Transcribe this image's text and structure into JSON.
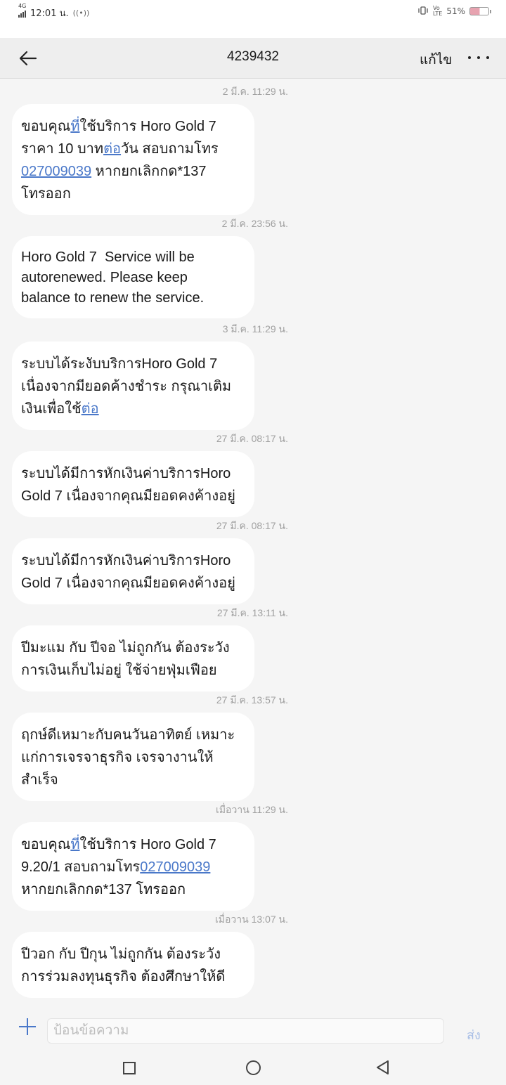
{
  "status_bar": {
    "time": "12:01 น.",
    "network": "4G",
    "battery_percent": "51%",
    "battery_level": 0.51
  },
  "header": {
    "title": "4239432",
    "edit_label": "แก้ไข",
    "back_icon": "arrow-left-icon",
    "more_icon": "more-horizontal-icon"
  },
  "messages": [
    {
      "timestamp": "2 มี.ค. 11:29 น.",
      "lines": [
        [
          {
            "t": "ขอบคุณ"
          },
          {
            "t": "ที่",
            "link": true
          },
          {
            "t": "ใช้บริการ Horo Gold 7"
          }
        ],
        [
          {
            "t": "ราคา 10 บาท"
          },
          {
            "t": "ต่อ",
            "link": true
          },
          {
            "t": "วัน สอบถามโทร"
          }
        ],
        [
          {
            "t": "027009039",
            "link": true
          },
          {
            "t": " หากยกเลิกกด*137"
          }
        ],
        [
          {
            "t": "โทรออก"
          }
        ]
      ]
    },
    {
      "timestamp": "2 มี.ค. 23:56 น.",
      "en": true,
      "lines": [
        [
          {
            "t": "Horo Gold 7  Service will be"
          }
        ],
        [
          {
            "t": "autorenewed. Please keep"
          }
        ],
        [
          {
            "t": "balance to renew the service."
          }
        ]
      ]
    },
    {
      "timestamp": "3 มี.ค. 11:29 น.",
      "lines": [
        [
          {
            "t": "ระบบได้ระงับบริการHoro Gold 7"
          }
        ],
        [
          {
            "t": "เนื่องจากมียอดค้างชำระ กรุณาเติม"
          }
        ],
        [
          {
            "t": "เงินเพื่อใช้"
          },
          {
            "t": "ต่อ",
            "link": true
          }
        ]
      ]
    },
    {
      "timestamp": "27 มี.ค. 08:17 น.",
      "lines": [
        [
          {
            "t": "ระบบได้มีการหักเงินค่าบริการHoro"
          }
        ],
        [
          {
            "t": "Gold 7 เนื่องจากคุณมียอดคงค้างอยู่"
          }
        ]
      ]
    },
    {
      "timestamp": "27 มี.ค. 08:17 น.",
      "lines": [
        [
          {
            "t": "ระบบได้มีการหักเงินค่าบริการHoro"
          }
        ],
        [
          {
            "t": "Gold 7 เนื่องจากคุณมียอดคงค้างอยู่"
          }
        ]
      ]
    },
    {
      "timestamp": "27 มี.ค. 13:11 น.",
      "lines": [
        [
          {
            "t": "ปีมะแม กับ ปีจอ ไม่ถูกกัน ต้องระวัง"
          }
        ],
        [
          {
            "t": "การเงินเก็บไม่อยู่ ใช้จ่ายฟุ่มเฟือย"
          }
        ]
      ]
    },
    {
      "timestamp": "27 มี.ค. 13:57 น.",
      "lines": [
        [
          {
            "t": "ฤกษ์ดีเหมาะกับคนวันอาทิตย์ เหมาะ"
          }
        ],
        [
          {
            "t": "แก่การเจรจาธุรกิจ เจรจางานให้"
          }
        ],
        [
          {
            "t": "สำเร็จ"
          }
        ]
      ]
    },
    {
      "timestamp": "เมื่อวาน 11:29 น.",
      "lines": [
        [
          {
            "t": "ขอบคุณ"
          },
          {
            "t": "ที่",
            "link": true
          },
          {
            "t": "ใช้บริการ Horo Gold 7"
          }
        ],
        [
          {
            "t": "9.20/1 สอบถามโทร"
          },
          {
            "t": "027009039",
            "link": true
          }
        ],
        [
          {
            "t": "หากยกเลิกกด*137 โทรออก"
          }
        ]
      ]
    },
    {
      "timestamp": "เมื่อวาน 13:07 น.",
      "lines": [
        [
          {
            "t": "ปีวอก กับ ปีกุน ไม่ถูกกัน ต้องระวัง"
          }
        ],
        [
          {
            "t": "การร่วมลงทุนธุรกิจ ต้องศึกษาให้ดี"
          }
        ]
      ]
    }
  ],
  "composer": {
    "placeholder": "ป้อนข้อความ",
    "send_label": "ส่ง",
    "add_icon": "plus-icon"
  },
  "nav": {
    "recent_icon": "square-icon",
    "home_icon": "circle-icon",
    "back_icon": "triangle-back-icon"
  }
}
